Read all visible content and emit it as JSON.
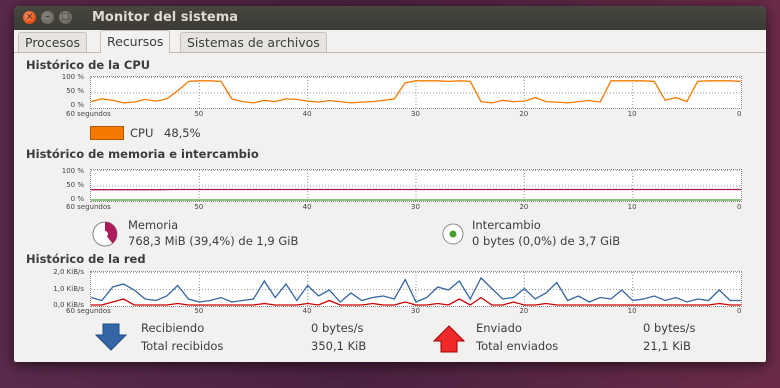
{
  "window": {
    "title": "Monitor del sistema"
  },
  "tabs": [
    {
      "label": "Procesos",
      "active": false
    },
    {
      "label": "Recursos",
      "active": true
    },
    {
      "label": "Sistemas de archivos",
      "active": false
    }
  ],
  "cpu": {
    "heading": "Histórico de la CPU",
    "y_ticks": [
      "100 %",
      "50 %",
      "0 %"
    ],
    "x_first": "60 segundos",
    "x_ticks": [
      "50",
      "40",
      "30",
      "20",
      "10",
      "0"
    ],
    "legend_label": "CPU",
    "legend_value": "48,5%",
    "color": "#f57900"
  },
  "memory": {
    "heading": "Histórico de memoria e intercambio",
    "y_ticks": [
      "100 %",
      "50 %",
      "0 %"
    ],
    "x_first": "60 segundos",
    "x_ticks": [
      "50",
      "40",
      "30",
      "20",
      "10",
      "0"
    ],
    "mem_label": "Memoria",
    "mem_value": "768,3 MiB (39,4%) de 1,9 GiB",
    "swap_label": "Intercambio",
    "swap_value": "0 bytes (0,0%) de 3,7 GiB",
    "mem_color": "#ad1c5a",
    "swap_color": "#4aa02c"
  },
  "network": {
    "heading": "Histórico de la red",
    "y_ticks": [
      "2,0 KiB/s",
      "1,0 KiB/s",
      "0,0 KiB/s"
    ],
    "x_first": "60 segundos",
    "x_ticks": [
      "50",
      "40",
      "30",
      "20",
      "10",
      "0"
    ],
    "recv_label": "Recibiendo",
    "recv_value": "0 bytes/s",
    "recv_total_label": "Total recibidos",
    "recv_total_value": "350,1 KiB",
    "sent_label": "Enviado",
    "sent_value": "0 bytes/s",
    "sent_total_label": "Total enviados",
    "sent_total_value": "21,1 KiB",
    "recv_color": "#3465a4",
    "sent_color": "#cc0000"
  },
  "chart_data": [
    {
      "type": "line",
      "title": "Histórico de la CPU",
      "x": [
        60,
        59,
        58,
        57,
        56,
        55,
        54,
        53,
        52,
        51,
        50,
        49,
        48,
        47,
        46,
        45,
        44,
        43,
        42,
        41,
        40,
        39,
        38,
        37,
        36,
        35,
        34,
        33,
        32,
        31,
        30,
        29,
        28,
        27,
        26,
        25,
        24,
        23,
        22,
        21,
        20,
        19,
        18,
        17,
        16,
        15,
        14,
        13,
        12,
        11,
        10,
        9,
        8,
        7,
        6,
        5,
        4,
        3,
        2,
        1,
        0
      ],
      "series": [
        {
          "name": "CPU",
          "values": [
            20,
            30,
            25,
            15,
            18,
            28,
            22,
            30,
            60,
            95,
            97,
            97,
            95,
            30,
            20,
            15,
            25,
            20,
            30,
            28,
            22,
            18,
            24,
            20,
            15,
            18,
            20,
            25,
            30,
            90,
            97,
            97,
            97,
            95,
            97,
            95,
            20,
            15,
            25,
            20,
            22,
            35,
            20,
            18,
            15,
            20,
            24,
            18,
            97,
            97,
            97,
            97,
            95,
            25,
            35,
            20,
            95,
            97,
            97,
            97,
            95
          ]
        }
      ],
      "ylim": [
        0,
        100
      ]
    },
    {
      "type": "line",
      "title": "Histórico de memoria e intercambio",
      "series": [
        {
          "name": "Memoria",
          "values": [
            38,
            38,
            38,
            38,
            39,
            39,
            39,
            39,
            39,
            39,
            39,
            39,
            39,
            39,
            39,
            39,
            39,
            39,
            39,
            39,
            39,
            39,
            39,
            39,
            39,
            39,
            39,
            39,
            39,
            39,
            39
          ]
        },
        {
          "name": "Intercambio",
          "values": [
            0,
            0,
            0,
            0,
            0,
            0,
            0,
            0,
            0,
            0,
            0,
            0,
            0,
            0,
            0,
            0,
            0,
            0,
            0,
            0,
            0,
            0,
            0,
            0,
            0,
            0,
            0,
            0,
            0,
            0,
            0
          ]
        }
      ],
      "ylim": [
        0,
        100
      ]
    },
    {
      "type": "line",
      "title": "Histórico de la red",
      "series": [
        {
          "name": "Recibiendo",
          "values": [
            0.5,
            0.3,
            1.2,
            1.4,
            1.0,
            0.4,
            0.3,
            0.6,
            1.3,
            0.4,
            0.2,
            0.3,
            0.5,
            0.2,
            0.3,
            0.4,
            1.6,
            0.5,
            1.4,
            0.3,
            1.3,
            0.6,
            1.0,
            0.2,
            0.8,
            0.3,
            0.5,
            0.6,
            0.4,
            1.7,
            0.2,
            0.5,
            1.2,
            1.0,
            1.6,
            0.4,
            1.8,
            1.1,
            0.4,
            0.5,
            1.1,
            0.4,
            0.8,
            1.5,
            0.3,
            0.6,
            0.2,
            0.5,
            0.4,
            1.0,
            0.3,
            0.4,
            0.6,
            0.3,
            0.5,
            0.2,
            0.4,
            0.3,
            1.0,
            0.3,
            0.3
          ]
        },
        {
          "name": "Enviado",
          "values": [
            0,
            0,
            0.2,
            0.4,
            0,
            0,
            0,
            0,
            0.1,
            0,
            0,
            0,
            0,
            0,
            0,
            0,
            0.1,
            0,
            0,
            0,
            0.1,
            0,
            0.3,
            0,
            0,
            0,
            0.1,
            0,
            0,
            0.2,
            0,
            0,
            0.1,
            0,
            0.4,
            0,
            0.5,
            0,
            0,
            0.2,
            0,
            0,
            0.1,
            0,
            0,
            0,
            0,
            0,
            0,
            0,
            0,
            0,
            0,
            0,
            0,
            0,
            0,
            0,
            0.1,
            0,
            0
          ]
        }
      ],
      "ylim": [
        0,
        2.0
      ]
    }
  ]
}
